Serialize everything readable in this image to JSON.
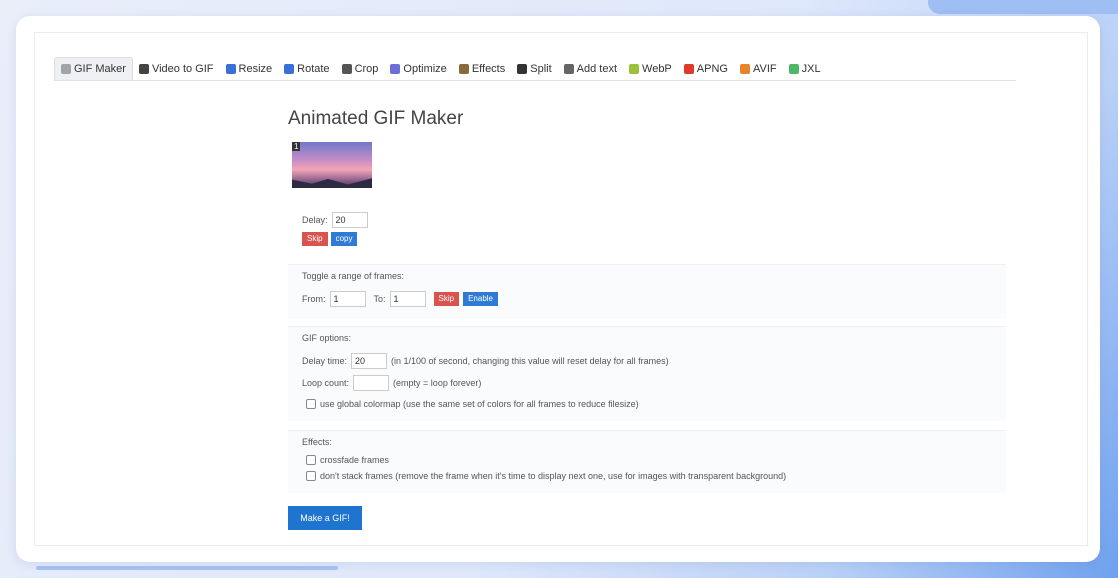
{
  "tabs": [
    {
      "label": "GIF Maker",
      "icon": "gif-maker-icon",
      "color": "#a0a3a8",
      "active": true
    },
    {
      "label": "Video to GIF",
      "icon": "video-icon",
      "color": "#444444"
    },
    {
      "label": "Resize",
      "icon": "resize-icon",
      "color": "#3a6fd8"
    },
    {
      "label": "Rotate",
      "icon": "rotate-icon",
      "color": "#3a6fd8"
    },
    {
      "label": "Crop",
      "icon": "crop-icon",
      "color": "#555555"
    },
    {
      "label": "Optimize",
      "icon": "optimize-icon",
      "color": "#6b6fd6"
    },
    {
      "label": "Effects",
      "icon": "effects-icon",
      "color": "#8a6a3a"
    },
    {
      "label": "Split",
      "icon": "split-icon",
      "color": "#333333"
    },
    {
      "label": "Add text",
      "icon": "add-text-icon",
      "color": "#666666"
    },
    {
      "label": "WebP",
      "icon": "webp-icon",
      "color": "#9bc13a"
    },
    {
      "label": "APNG",
      "icon": "apng-icon",
      "color": "#e03a2a"
    },
    {
      "label": "AVIF",
      "icon": "avif-icon",
      "color": "#e8852a"
    },
    {
      "label": "JXL",
      "icon": "jxl-icon",
      "color": "#4cb86a"
    }
  ],
  "main": {
    "title": "Animated GIF Maker",
    "frame": {
      "number": "1",
      "delay_label": "Delay:",
      "delay_value": "20",
      "skip_label": "Skip",
      "copy_label": "copy"
    },
    "toggle": {
      "title": "Toggle a range of frames:",
      "from_label": "From:",
      "from_value": "1",
      "to_label": "To:",
      "to_value": "1",
      "skip_label": "Skip",
      "enable_label": "Enable"
    },
    "gif_options": {
      "title": "GIF options:",
      "delay_label": "Delay time:",
      "delay_value": "20",
      "delay_hint": "(in 1/100 of second, changing this value will reset delay for all frames)",
      "loop_label": "Loop count:",
      "loop_value": "",
      "loop_hint": "(empty = loop forever)",
      "colormap_label": "use global colormap (use the same set of colors for all frames to reduce filesize)"
    },
    "effects": {
      "title": "Effects:",
      "crossfade_label": "crossfade frames",
      "stack_label": "don't stack frames (remove the frame when it's time to display next one, use for images with transparent background)"
    },
    "make_button": "Make a GIF!"
  },
  "colors": {
    "accent_blue": "#1f74cf",
    "danger_red": "#d9534f"
  }
}
